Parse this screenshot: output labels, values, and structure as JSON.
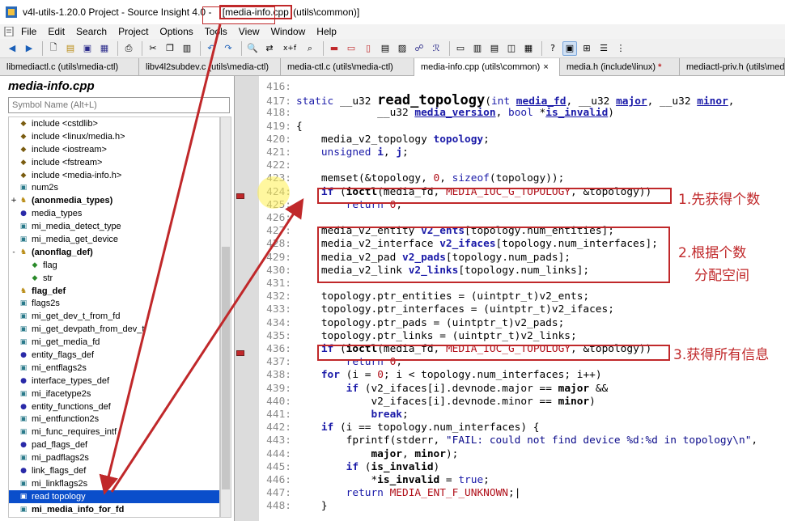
{
  "window": {
    "title_prefix": "v4l-utils-1.20.0 Project - Source Insight 4.0 - ",
    "title_file": "[media-info.cpp",
    "title_suffix": " (utils\\common)]"
  },
  "menu": [
    "File",
    "Edit",
    "Search",
    "Project",
    "Options",
    "Tools",
    "View",
    "Window",
    "Help"
  ],
  "toolbar": {
    "icons": [
      "back-icon",
      "forward-icon",
      "new-file-icon",
      "open-file-icon",
      "save-icon",
      "save-all-icon",
      "print-icon",
      "cut-icon",
      "copy-icon",
      "paste-icon",
      "undo-icon",
      "redo-icon",
      "find-icon",
      "replace-icon",
      "xref-icon",
      "lookup-icon",
      "bookmark-icon",
      "jump-icon",
      "browse-icon",
      "symbol-info-icon",
      "context-icon",
      "relation-icon",
      "layout-1-icon",
      "layout-2-icon",
      "layout-3-icon",
      "layout-4-icon",
      "layout-5-icon",
      "help-icon",
      "panel-icon",
      "grid-icon",
      "list-icon",
      "tree-icon"
    ],
    "xref_label": "x+f"
  },
  "tabs": [
    {
      "label": "libmediactl.c (utils\\media-ctl)",
      "active": false,
      "dirty": false
    },
    {
      "label": "libv4l2subdev.c (utils\\media-ctl)",
      "active": false,
      "dirty": false
    },
    {
      "label": "media-ctl.c (utils\\media-ctl)",
      "active": false,
      "dirty": false
    },
    {
      "label": "media-info.cpp (utils\\common)",
      "active": true,
      "dirty": false,
      "close": "×"
    },
    {
      "label": "media.h (include\\linux)",
      "active": false,
      "dirty": true,
      "dirty_mark": "*"
    },
    {
      "label": "mediactl-priv.h (utils\\media",
      "active": false,
      "dirty": false
    }
  ],
  "sidebar": {
    "title": "media-info.cpp",
    "search_placeholder": "Symbol Name (Alt+L)",
    "symbols": [
      {
        "twist": "",
        "kind": "include",
        "label": "include <cstdlib>",
        "bold": false
      },
      {
        "twist": "",
        "kind": "include",
        "label": "include <linux/media.h>",
        "bold": false
      },
      {
        "twist": "",
        "kind": "include",
        "label": "include <iostream>",
        "bold": false
      },
      {
        "twist": "",
        "kind": "include",
        "label": "include <fstream>",
        "bold": false
      },
      {
        "twist": "",
        "kind": "include",
        "label": "include <media-info.h>",
        "bold": false
      },
      {
        "twist": "",
        "kind": "var",
        "label": "num2s",
        "bold": false
      },
      {
        "twist": "+",
        "kind": "struct",
        "label": "(anonmedia_types)",
        "bold": true
      },
      {
        "twist": "",
        "kind": "type",
        "label": "media_types",
        "bold": false
      },
      {
        "twist": "",
        "kind": "func",
        "label": "mi_media_detect_type",
        "bold": false
      },
      {
        "twist": "",
        "kind": "func",
        "label": "mi_media_get_device",
        "bold": false
      },
      {
        "twist": "-",
        "kind": "struct",
        "label": "(anonflag_def)",
        "bold": true
      },
      {
        "twist": "",
        "kind": "member",
        "label": "flag",
        "bold": false,
        "indent": true
      },
      {
        "twist": "",
        "kind": "member",
        "label": "str",
        "bold": false,
        "indent": true
      },
      {
        "twist": "",
        "kind": "struct",
        "label": "flag_def",
        "bold": true
      },
      {
        "twist": "",
        "kind": "func",
        "label": "flags2s",
        "bold": false
      },
      {
        "twist": "",
        "kind": "func",
        "label": "mi_get_dev_t_from_fd",
        "bold": false
      },
      {
        "twist": "",
        "kind": "func",
        "label": "mi_get_devpath_from_dev_t",
        "bold": false
      },
      {
        "twist": "",
        "kind": "func",
        "label": "mi_get_media_fd",
        "bold": false
      },
      {
        "twist": "",
        "kind": "type",
        "label": "entity_flags_def",
        "bold": false
      },
      {
        "twist": "",
        "kind": "func",
        "label": "mi_entflags2s",
        "bold": false
      },
      {
        "twist": "",
        "kind": "type",
        "label": "interface_types_def",
        "bold": false
      },
      {
        "twist": "",
        "kind": "func",
        "label": "mi_ifacetype2s",
        "bold": false
      },
      {
        "twist": "",
        "kind": "type",
        "label": "entity_functions_def",
        "bold": false
      },
      {
        "twist": "",
        "kind": "func",
        "label": "mi_entfunction2s",
        "bold": false
      },
      {
        "twist": "",
        "kind": "func",
        "label": "mi_func_requires_intf",
        "bold": false
      },
      {
        "twist": "",
        "kind": "type",
        "label": "pad_flags_def",
        "bold": false
      },
      {
        "twist": "",
        "kind": "func",
        "label": "mi_padflags2s",
        "bold": false
      },
      {
        "twist": "",
        "kind": "type",
        "label": "link_flags_def",
        "bold": false
      },
      {
        "twist": "",
        "kind": "func",
        "label": "mi_linkflags2s",
        "bold": false
      },
      {
        "twist": "",
        "kind": "func",
        "label": "read topology",
        "bold": false,
        "selected": true
      },
      {
        "twist": "",
        "kind": "func",
        "label": "mi_media_info_for_fd",
        "bold": true
      }
    ]
  },
  "code": {
    "lines": [
      {
        "n": "416:",
        "html": ""
      },
      {
        "n": "417:",
        "html": "<span class='kw'>static</span> __u32 <span class='fnbig'>read_topology</span>(<span class='kw'>int</span> <span class='id ul'>media_fd</span>, __u32 <span class='id ul'>major</span>, __u32 <span class='id ul'>minor</span>,"
      },
      {
        "n": "418:",
        "html": "             __u32 <span class='id ul'>media_version</span>, <span class='kw'>bool</span> *<span class='id ul'>is_invalid</span>)"
      },
      {
        "n": "419:",
        "html": "{"
      },
      {
        "n": "420:",
        "html": "    media_v2_topology <span class='id'>topology</span>;"
      },
      {
        "n": "421:",
        "html": "    <span class='kw'>unsigned</span> <span class='id'>i</span>, <span class='id'>j</span>;"
      },
      {
        "n": "422:",
        "html": ""
      },
      {
        "n": "423:",
        "html": "    memset(&amp;topology, <span class='lit'>0</span>, <span class='kw'>sizeof</span>(topology));"
      },
      {
        "n": "424:",
        "html": "    <span class='kw'><b>if</b></span> (<b>ioctl</b>(media_fd, <span class='lit'>MEDIA_IOC_G_TOPOLOGY</span>, &amp;topology))"
      },
      {
        "n": "425:",
        "html": "        <span class='kw'>return</span> <span class='lit'>0</span>;"
      },
      {
        "n": "426:",
        "html": ""
      },
      {
        "n": "427:",
        "html": "    media_v2_entity <span class='id'>v2_ents</span>[topology.num_entities];"
      },
      {
        "n": "428:",
        "html": "    media_v2_interface <span class='id'>v2_ifaces</span>[topology.num_interfaces];"
      },
      {
        "n": "429:",
        "html": "    media_v2_pad <span class='id'>v2_pads</span>[topology.num_pads];"
      },
      {
        "n": "430:",
        "html": "    media_v2_link <span class='id'>v2_links</span>[topology.num_links];"
      },
      {
        "n": "431:",
        "html": ""
      },
      {
        "n": "432:",
        "html": "    topology.ptr_entities = (uintptr_t)v2_ents;"
      },
      {
        "n": "433:",
        "html": "    topology.ptr_interfaces = (uintptr_t)v2_ifaces;"
      },
      {
        "n": "434:",
        "html": "    topology.ptr_pads = (uintptr_t)v2_pads;"
      },
      {
        "n": "435:",
        "html": "    topology.ptr_links = (uintptr_t)v2_links;"
      },
      {
        "n": "436:",
        "html": "    <span class='kw'><b>if</b></span> (<b>ioctl</b>(media_fd, <span class='lit'>MEDIA_IOC_G_TOPOLOGY</span>, &amp;topology))"
      },
      {
        "n": "437:",
        "html": "        <span class='kw'>return</span> <span class='lit'>0</span>;"
      },
      {
        "n": "438:",
        "html": "    <span class='kw'><b>for</b></span> (i = <span class='lit'>0</span>; i &lt; topology.num_interfaces; i++)"
      },
      {
        "n": "439:",
        "html": "        <span class='kw'><b>if</b></span> (v2_ifaces[i].devnode.major == <b>major</b> &amp;&amp;"
      },
      {
        "n": "440:",
        "html": "            v2_ifaces[i].devnode.minor == <b>minor</b>)"
      },
      {
        "n": "441:",
        "html": "            <span class='kw'><b>break</b></span>;"
      },
      {
        "n": "442:",
        "html": "    <span class='kw'><b>if</b></span> (i == topology.num_interfaces) {"
      },
      {
        "n": "443:",
        "html": "        fprintf(stderr, <span class='str'>\"FAIL: could not find device %d:%d in topology\\n\"</span>,"
      },
      {
        "n": "444:",
        "html": "            <b>major</b>, <b>minor</b>);"
      },
      {
        "n": "445:",
        "html": "        <span class='kw'><b>if</b></span> (<b>is_invalid</b>)"
      },
      {
        "n": "446:",
        "html": "            *<b>is_invalid</b> = <span class='kw'>true</span>;"
      },
      {
        "n": "447:",
        "html": "        <span class='kw'>return</span> <span class='lit'>MEDIA_ENT_F_UNKNOWN</span>;|"
      },
      {
        "n": "448:",
        "html": "    }"
      }
    ]
  },
  "annotations": {
    "note1": "1.先获得个数",
    "note2a": "2.根据个数",
    "note2b": "分配空间",
    "note3": "3.获得所有信息"
  },
  "colors": {
    "accent_red": "#c0282a",
    "selection_blue": "#0a4ecb",
    "keyword_blue": "#1a1aa8"
  }
}
